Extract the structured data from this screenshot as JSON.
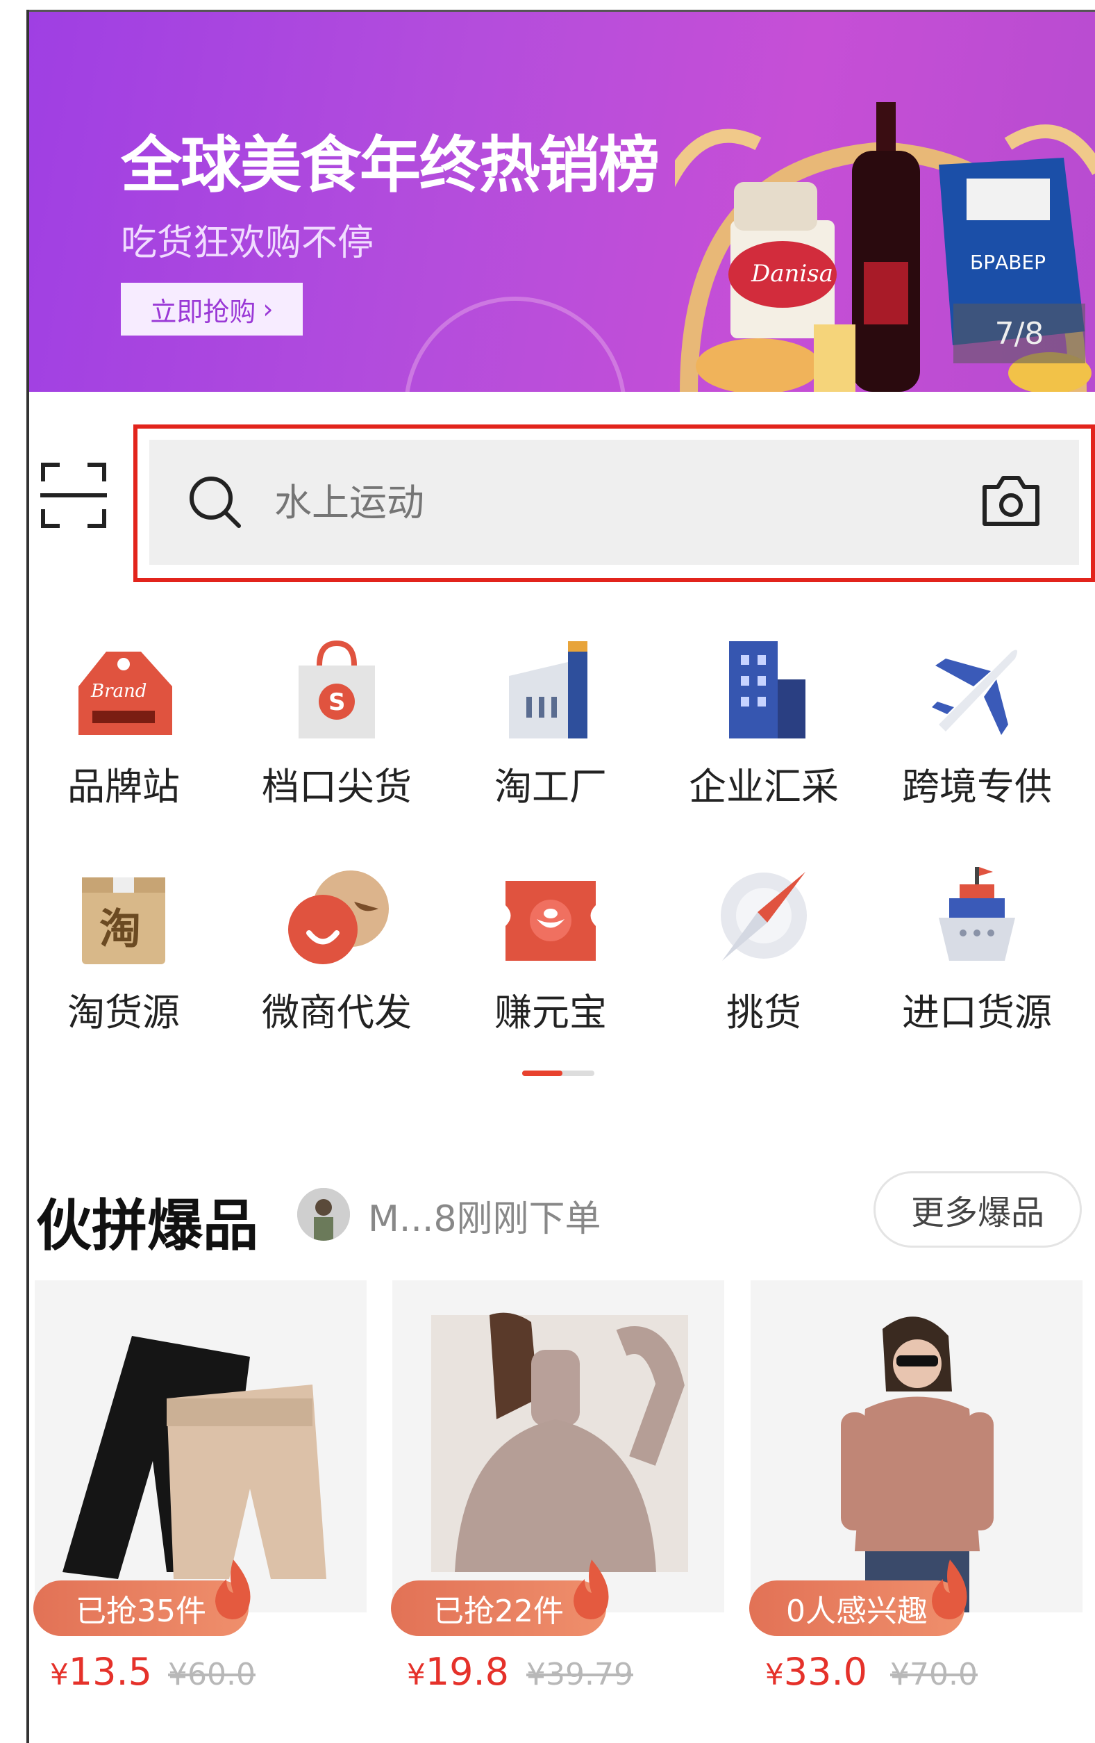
{
  "banner": {
    "title": "全球美食年终热销榜",
    "subtitle": "吃货狂欢购不停",
    "button_label": "立即抢购",
    "counter": "7/8"
  },
  "search": {
    "placeholder": "水上运动"
  },
  "categories": [
    {
      "label": "品牌站",
      "icon": "brand-tag-icon"
    },
    {
      "label": "档口尖货",
      "icon": "shopping-bag-icon"
    },
    {
      "label": "淘工厂",
      "icon": "factory-icon"
    },
    {
      "label": "企业汇采",
      "icon": "office-building-icon"
    },
    {
      "label": "跨境专供",
      "icon": "airplane-icon"
    },
    {
      "label": "淘货源",
      "icon": "tao-box-icon"
    },
    {
      "label": "微商代发",
      "icon": "smile-bubble-icon"
    },
    {
      "label": "赚元宝",
      "icon": "ingot-ticket-icon"
    },
    {
      "label": "挑货",
      "icon": "compass-icon"
    },
    {
      "label": "进口货源",
      "icon": "ship-icon"
    }
  ],
  "pager": {
    "active_index": 0,
    "pages": 2
  },
  "section": {
    "title": "伙拼爆品",
    "ticker": "M...8刚刚下单",
    "more_label": "更多爆品"
  },
  "products": [
    {
      "badge": "已抢35件",
      "price": "13.5",
      "original_price": "¥60.0",
      "currency": "¥"
    },
    {
      "badge": "已抢22件",
      "price": "19.8",
      "original_price": "¥39.79",
      "currency": "¥"
    },
    {
      "badge": "0人感兴趣",
      "price": "33.0",
      "original_price": "¥70.0",
      "currency": "¥"
    }
  ],
  "colors": {
    "accent": "#e5312a",
    "banner_purple": "#b44ddc",
    "highlight_outline": "#e2241c"
  }
}
